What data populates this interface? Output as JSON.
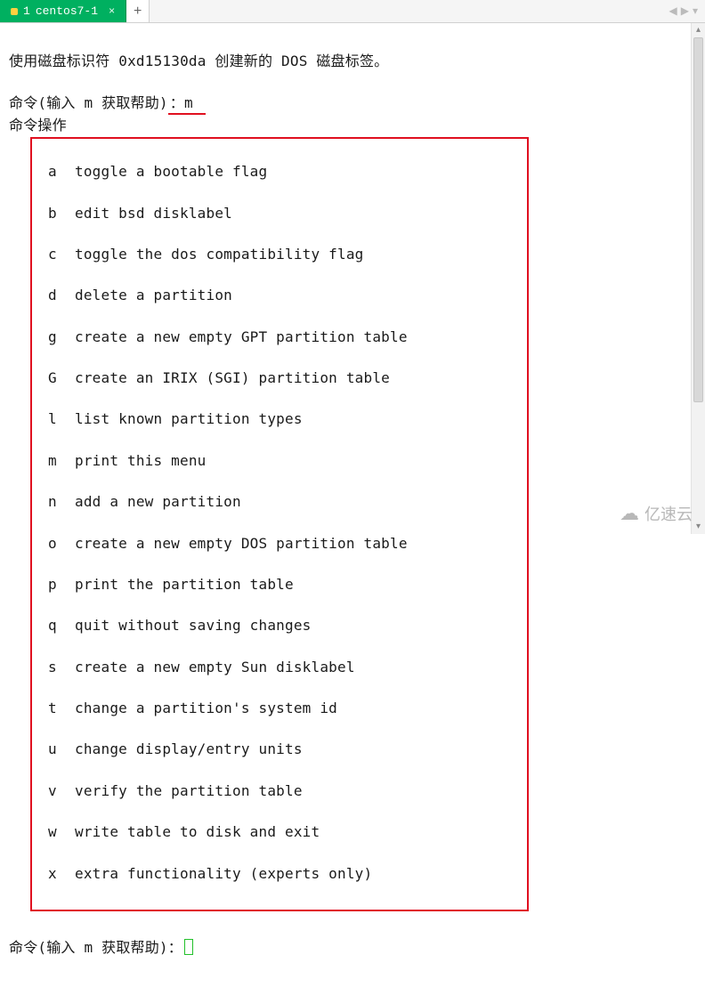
{
  "tab": {
    "index": "1",
    "title": "centos7-1",
    "close_glyph": "×",
    "add_glyph": "+"
  },
  "nav": {
    "left": "◀",
    "right": "▶",
    "menu": "▾"
  },
  "terminal": {
    "line1": "使用磁盘标识符 0xd15130da 创建新的 DOS 磁盘标签。",
    "blank": "",
    "prompt_prefix": "命令(输入 m 获取帮助)",
    "prompt_colon": "：",
    "entered": "m",
    "ops_header": "命令操作",
    "help": [
      {
        "k": "a",
        "d": "toggle a bootable flag"
      },
      {
        "k": "b",
        "d": "edit bsd disklabel"
      },
      {
        "k": "c",
        "d": "toggle the dos compatibility flag"
      },
      {
        "k": "d",
        "d": "delete a partition"
      },
      {
        "k": "g",
        "d": "create a new empty GPT partition table"
      },
      {
        "k": "G",
        "d": "create an IRIX (SGI) partition table"
      },
      {
        "k": "l",
        "d": "list known partition types"
      },
      {
        "k": "m",
        "d": "print this menu"
      },
      {
        "k": "n",
        "d": "add a new partition"
      },
      {
        "k": "o",
        "d": "create a new empty DOS partition table"
      },
      {
        "k": "p",
        "d": "print the partition table"
      },
      {
        "k": "q",
        "d": "quit without saving changes"
      },
      {
        "k": "s",
        "d": "create a new empty Sun disklabel"
      },
      {
        "k": "t",
        "d": "change a partition's system id"
      },
      {
        "k": "u",
        "d": "change display/entry units"
      },
      {
        "k": "v",
        "d": "verify the partition table"
      },
      {
        "k": "w",
        "d": "write table to disk and exit"
      },
      {
        "k": "x",
        "d": "extra functionality (experts only)"
      }
    ]
  },
  "watermark": {
    "cloud": "☁",
    "text": "亿速云"
  }
}
